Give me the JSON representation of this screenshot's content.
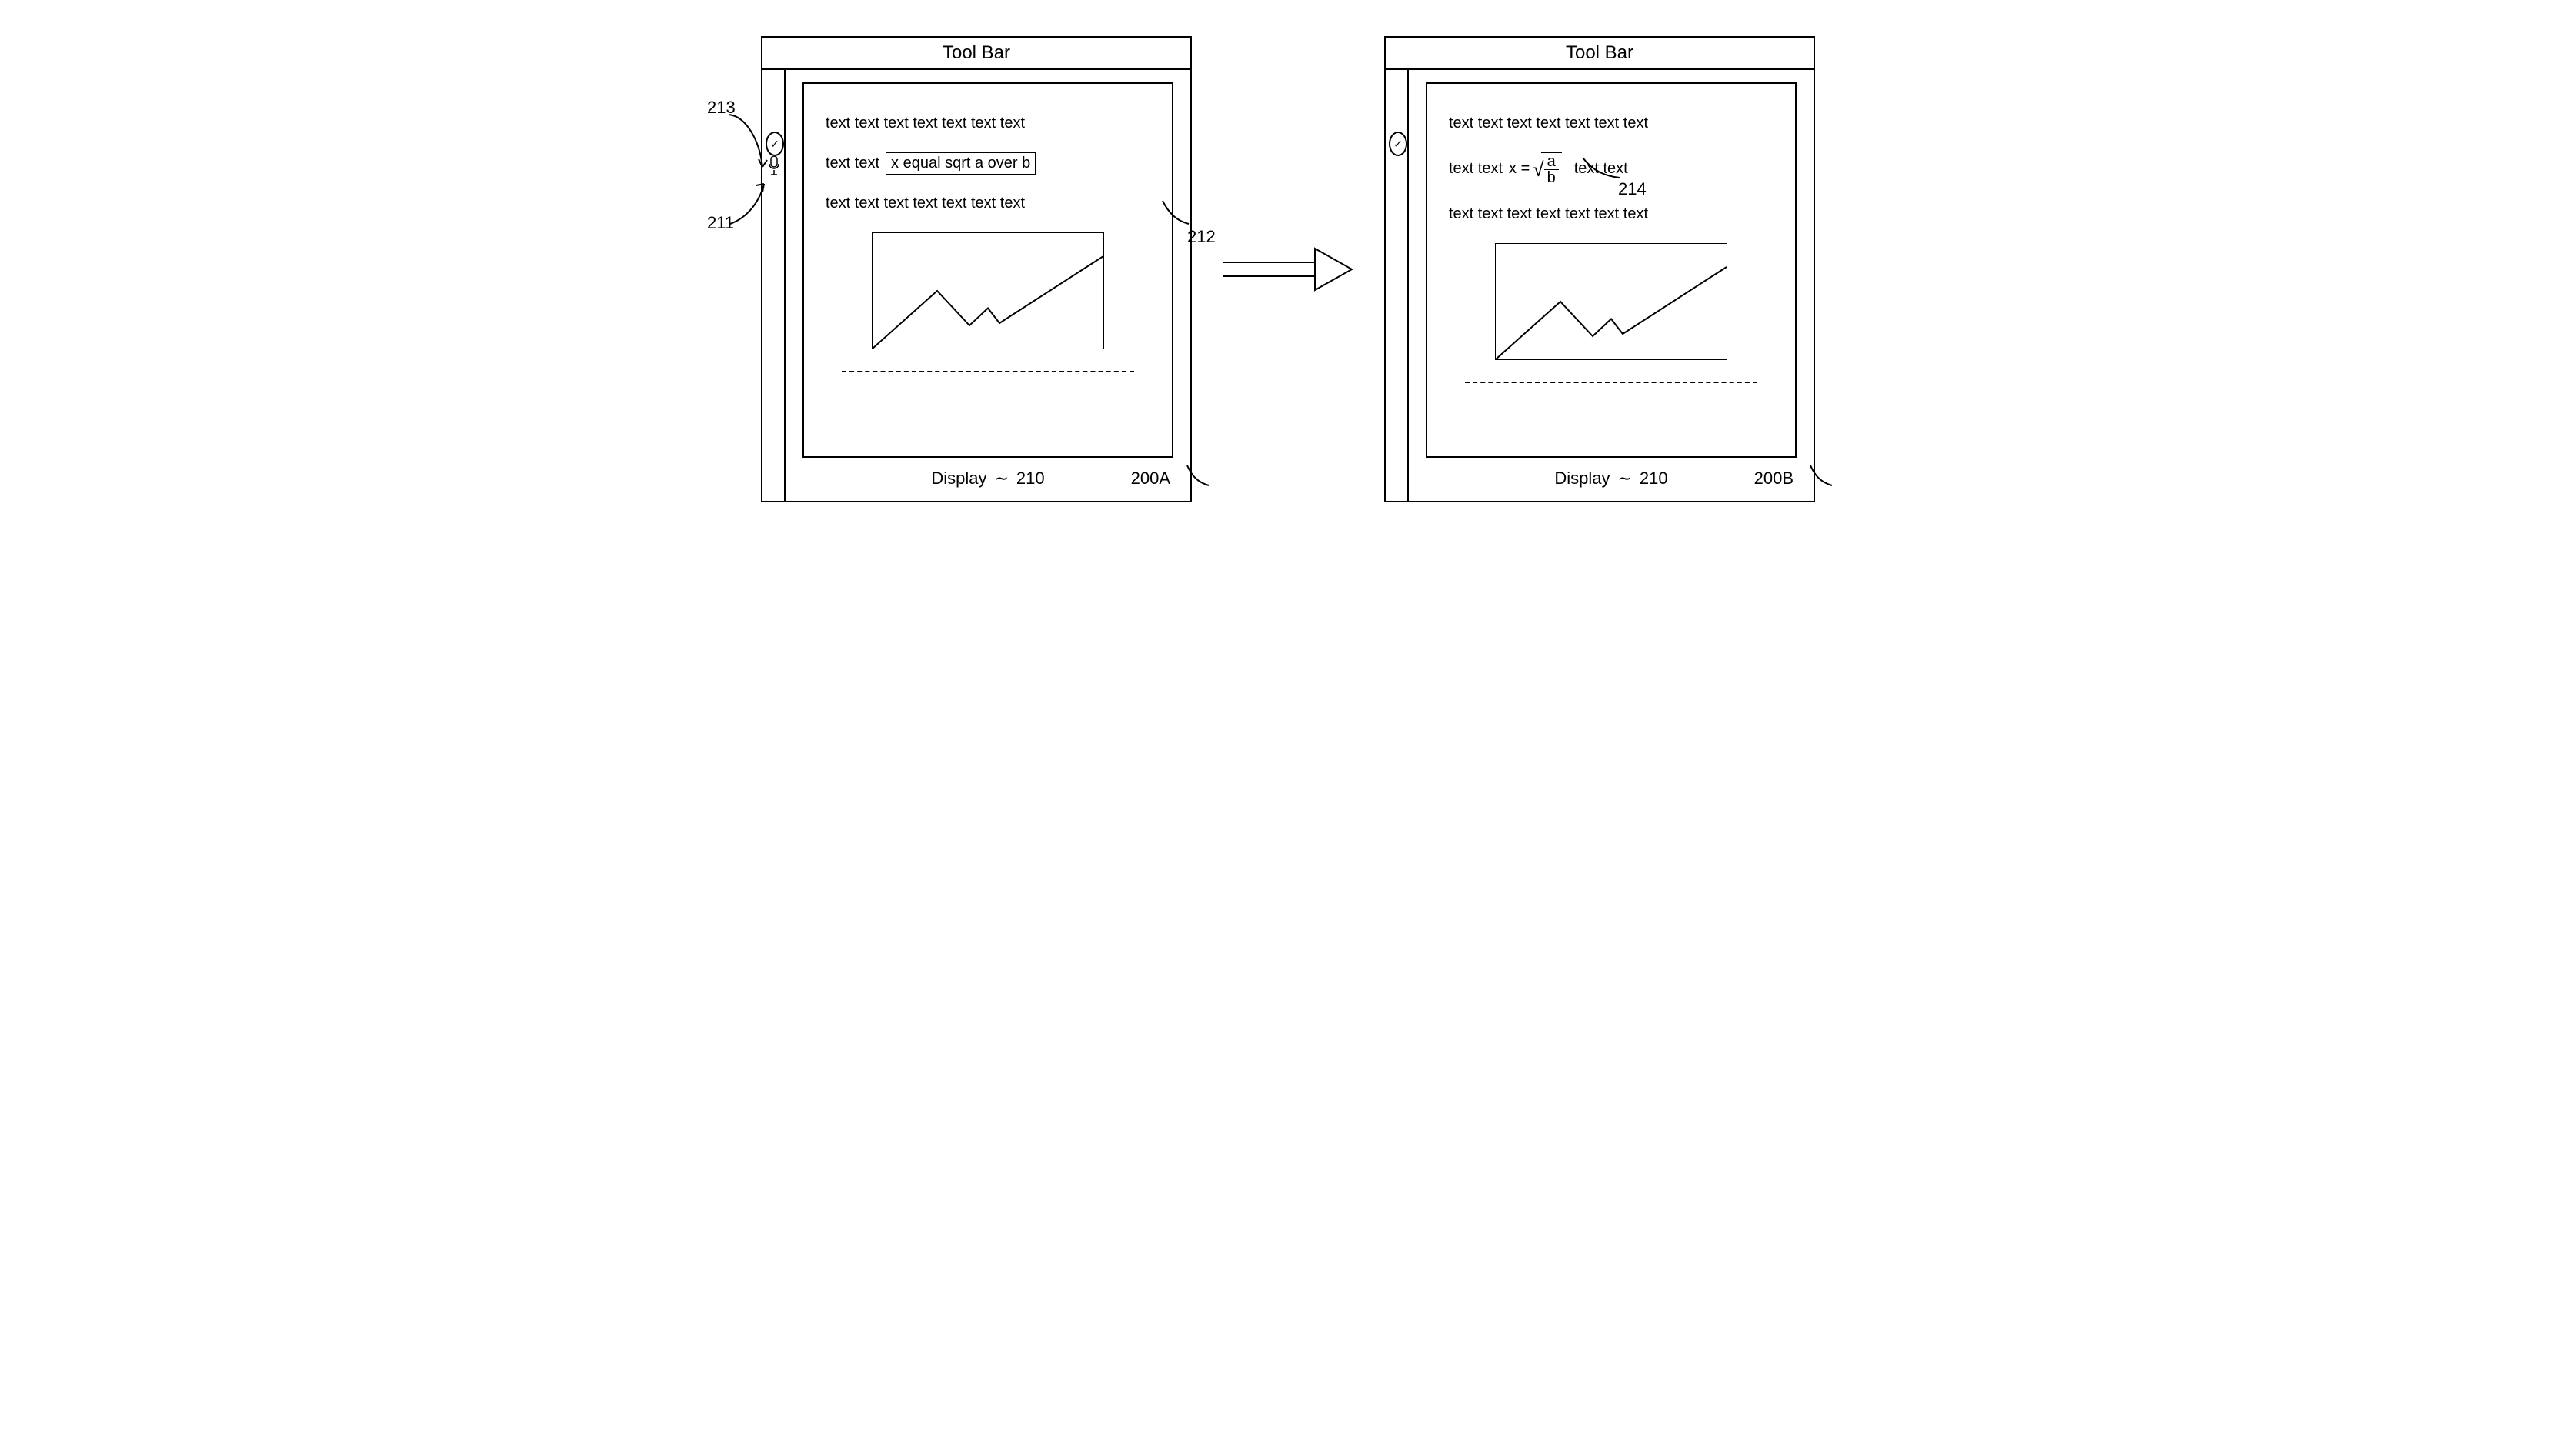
{
  "toolbar_label": "Tool Bar",
  "display_label": "Display",
  "display_ref": "210",
  "panel_left": {
    "id": "200A",
    "line1": "text text text text text text text",
    "line2_prefix": "text text",
    "boxed_text": "x equal sqrt a over b",
    "line3": "text text text text text text text",
    "ref_labels": {
      "check": "213",
      "mic": "211",
      "box": "212"
    }
  },
  "panel_right": {
    "id": "200B",
    "line1": "text text text text text text text",
    "line2_prefix": "text text",
    "equation": {
      "lhs": "x =",
      "num": "a",
      "den": "b"
    },
    "line2_suffix": "text text",
    "line3": "text text text text text text text",
    "ref_labels": {
      "eq": "214"
    }
  },
  "chart_data": {
    "type": "line",
    "x": [
      0,
      0.28,
      0.42,
      0.5,
      0.55,
      1.0
    ],
    "y": [
      0,
      0.5,
      0.2,
      0.35,
      0.22,
      0.8
    ],
    "title": "",
    "xlabel": "",
    "ylabel": "",
    "note": "values are normalized 0–1 estimates from a schematic patent drawing; no axes/ticks shown"
  }
}
